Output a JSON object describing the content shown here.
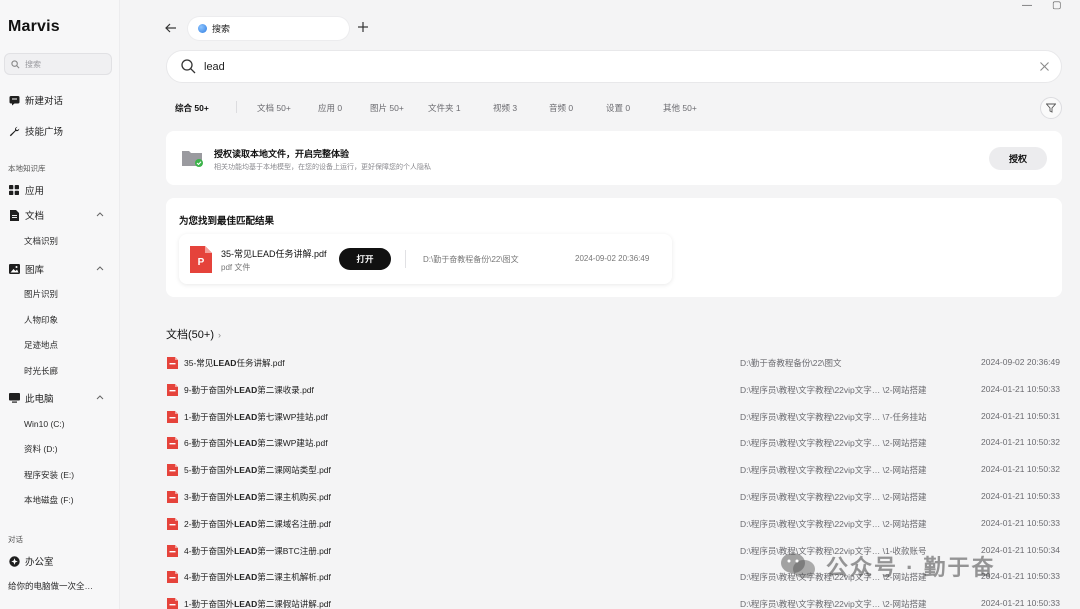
{
  "sidebar": {
    "brand": "Marvis",
    "search_placeholder": "搜索",
    "new_chat": "新建对话",
    "skill_plaza": "技能广场",
    "kb_section": "本地知识库",
    "apps": "应用",
    "docs": "文档",
    "doc_recognition": "文档识别",
    "gallery": "图库",
    "gallery_items": [
      "图片识别",
      "人物印象",
      "足迹地点",
      "时光长廊"
    ],
    "this_pc": "此电脑",
    "drives": [
      "Win10 (C:)",
      "资料 (D:)",
      "程序安装 (E:)",
      "本地磁盘 (F:)"
    ],
    "chat_section": "对话",
    "office": "办公室",
    "recent_chat": "给你的电脑做一次全…"
  },
  "topbar": {
    "tab_label": "搜索",
    "minimize": "—",
    "maximize": "▢"
  },
  "search": {
    "query": "lead"
  },
  "filters": [
    "综合 50+",
    "文档 50+",
    "应用 0",
    "图片 50+",
    "文件夹 1",
    "视频 3",
    "音频 0",
    "设置 0",
    "其他 50+"
  ],
  "auth": {
    "title": "授权读取本地文件，开启完整体验",
    "subtitle": "相关功能均基于本地模型，在您的设备上运行，更好保障您的个人隐私",
    "button": "授权"
  },
  "best_match": {
    "heading": "为您找到最佳匹配结果",
    "file_name": "35-常见LEAD任务讲解.pdf",
    "file_type": "pdf 文件",
    "open_label": "打开",
    "path": "D:\\勤于奋教程备份\\22\\图文",
    "time": "2024-09-02 20:36:49"
  },
  "docs": {
    "title": "文档(50+)",
    "arrow": "›",
    "rows": [
      {
        "pre": "35-常见",
        "hl": "LEAD",
        "post": "任务讲解.pdf",
        "path": "D:\\勤于奋教程备份\\22\\图文",
        "time": "2024-09-02 20:36:49"
      },
      {
        "pre": "9-勤于奋国外",
        "hl": "LEAD",
        "post": "第二课收录.pdf",
        "path": "D:\\程序员\\教程\\文字教程\\22vip文字… \\2-网站搭建",
        "time": "2024-01-21 10:50:33"
      },
      {
        "pre": "1-勤于奋国外",
        "hl": "LEAD",
        "post": "第七课WP挂站.pdf",
        "path": "D:\\程序员\\教程\\文字教程\\22vip文字… \\7-任务挂站",
        "time": "2024-01-21 10:50:31"
      },
      {
        "pre": "6-勤于奋国外",
        "hl": "LEAD",
        "post": "第二课WP建站.pdf",
        "path": "D:\\程序员\\教程\\文字教程\\22vip文字… \\2-网站搭建",
        "time": "2024-01-21 10:50:32"
      },
      {
        "pre": "5-勤于奋国外",
        "hl": "LEAD",
        "post": "第二课网站类型.pdf",
        "path": "D:\\程序员\\教程\\文字教程\\22vip文字… \\2-网站搭建",
        "time": "2024-01-21 10:50:32"
      },
      {
        "pre": "3-勤于奋国外",
        "hl": "LEAD",
        "post": "第二课主机购买.pdf",
        "path": "D:\\程序员\\教程\\文字教程\\22vip文字… \\2-网站搭建",
        "time": "2024-01-21 10:50:33"
      },
      {
        "pre": "2-勤于奋国外",
        "hl": "LEAD",
        "post": "第二课域名注册.pdf",
        "path": "D:\\程序员\\教程\\文字教程\\22vip文字… \\2-网站搭建",
        "time": "2024-01-21 10:50:33"
      },
      {
        "pre": "4-勤于奋国外",
        "hl": "LEAD",
        "post": "第一课BTC注册.pdf",
        "path": "D:\\程序员\\教程\\文字教程\\22vip文字… \\1-收款账号",
        "time": "2024-01-21 10:50:34"
      },
      {
        "pre": "4-勤于奋国外",
        "hl": "LEAD",
        "post": "第二课主机解析.pdf",
        "path": "D:\\程序员\\教程\\文字教程\\22vip文字… \\2-网站搭建",
        "time": "2024-01-21 10:50:33"
      },
      {
        "pre": "1-勤于奋国外",
        "hl": "LEAD",
        "post": "第二课假站讲解.pdf",
        "path": "D:\\程序员\\教程\\文字教程\\22vip文字… \\2-网站搭建",
        "time": "2024-01-21 10:50:33"
      }
    ]
  },
  "watermark": "公众号 · 勤于奋",
  "colors": {
    "accent_pdf": "#e5433b",
    "open_button": "#111111",
    "background": "#f4f4f5"
  }
}
